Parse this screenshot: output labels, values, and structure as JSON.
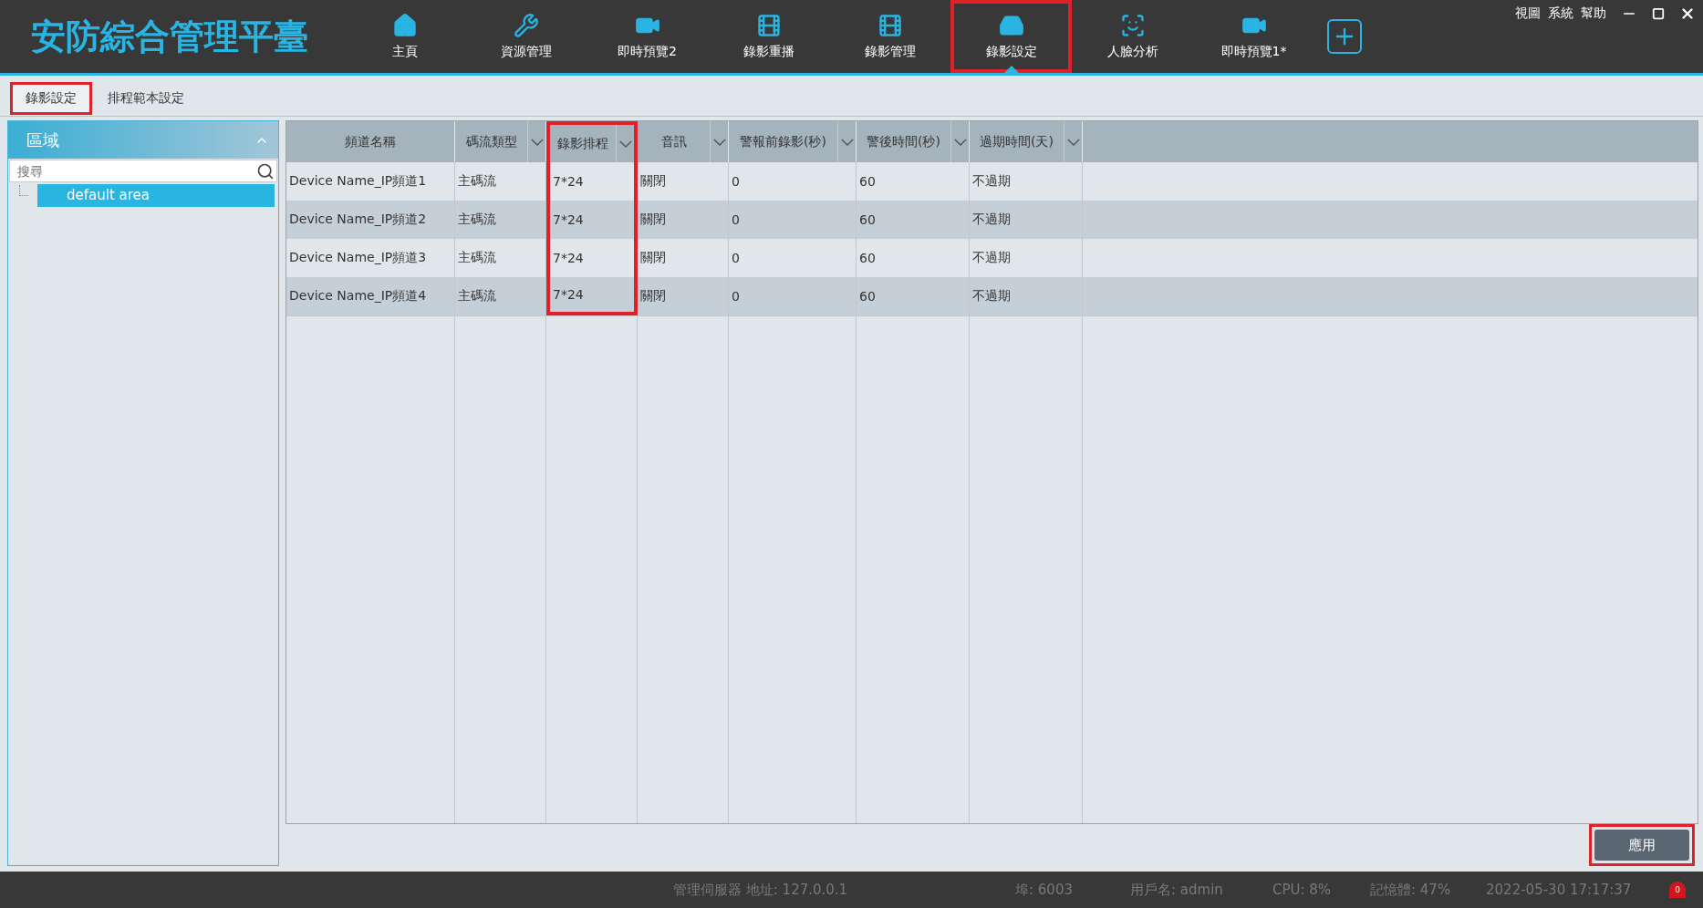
{
  "app_title": "安防綜合管理平臺",
  "nav": [
    {
      "label": "主頁",
      "selected": false,
      "highlighted": false
    },
    {
      "label": "資源管理",
      "selected": false,
      "highlighted": false
    },
    {
      "label": "即時預覽2",
      "selected": false,
      "highlighted": false
    },
    {
      "label": "錄影重播",
      "selected": false,
      "highlighted": false
    },
    {
      "label": "錄影管理",
      "selected": false,
      "highlighted": false
    },
    {
      "label": "錄影設定",
      "selected": true,
      "highlighted": true
    },
    {
      "label": "人臉分析",
      "selected": false,
      "highlighted": false
    },
    {
      "label": "即時預覽1*",
      "selected": false,
      "highlighted": false
    }
  ],
  "menu": [
    "視圖",
    "系統",
    "幫助"
  ],
  "subtabs": [
    {
      "label": "錄影設定",
      "selected": true,
      "highlighted": true
    },
    {
      "label": "排程範本設定",
      "selected": false,
      "highlighted": false
    }
  ],
  "sidebar": {
    "title": "區域",
    "expanded": true,
    "search": {
      "placeholder": "搜尋"
    },
    "tree": [
      {
        "label": "default area",
        "selected": true
      }
    ]
  },
  "table": {
    "columns": [
      {
        "label": "頻道名稱",
        "filter": false,
        "highlighted": false
      },
      {
        "label": "碼流類型",
        "filter": true,
        "highlighted": false
      },
      {
        "label": "錄影排程",
        "filter": true,
        "highlighted": true
      },
      {
        "label": "音訊",
        "filter": true,
        "highlighted": false
      },
      {
        "label": "警報前錄影(秒)",
        "filter": true,
        "highlighted": false
      },
      {
        "label": "警後時間(秒)",
        "filter": true,
        "highlighted": false
      },
      {
        "label": "過期時間(天)",
        "filter": true,
        "highlighted": false
      }
    ],
    "rows": [
      [
        "Device Name_IP頻道1",
        "主碼流",
        "7*24",
        "關閉",
        "0",
        "60",
        "不過期"
      ],
      [
        "Device Name_IP頻道2",
        "主碼流",
        "7*24",
        "關閉",
        "0",
        "60",
        "不過期"
      ],
      [
        "Device Name_IP頻道3",
        "主碼流",
        "7*24",
        "關閉",
        "0",
        "60",
        "不過期"
      ],
      [
        "Device Name_IP頻道4",
        "主碼流",
        "7*24",
        "關閉",
        "0",
        "60",
        "不過期"
      ]
    ]
  },
  "apply_button": {
    "label": "應用",
    "highlighted": true
  },
  "status_bar": {
    "server": "管理伺服器 地址: 127.0.0.1",
    "port": "埠: 6003",
    "user": "用戶名: admin",
    "cpu": "CPU: 8%",
    "memory": "記憶體: 47%",
    "datetime": "2022-05-30 17:17:37",
    "alarm_count": "0"
  }
}
